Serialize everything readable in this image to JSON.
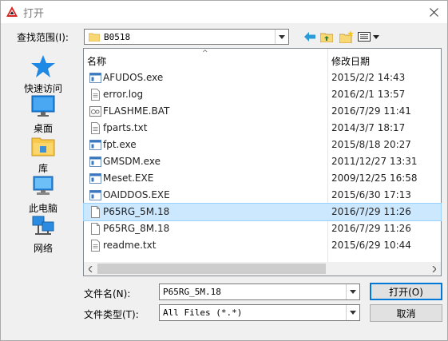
{
  "window": {
    "title": "打开"
  },
  "lookin": {
    "label": "查找范围(I):",
    "value": "B0518"
  },
  "places": [
    {
      "label": "快速访问",
      "icon": "star-icon"
    },
    {
      "label": "桌面",
      "icon": "desktop-icon"
    },
    {
      "label": "库",
      "icon": "library-icon"
    },
    {
      "label": "此电脑",
      "icon": "computer-icon"
    },
    {
      "label": "网络",
      "icon": "network-icon"
    }
  ],
  "columns": {
    "name": "名称",
    "date": "修改日期"
  },
  "files": [
    {
      "name": "AFUDOS.exe",
      "date": "2015/2/2 14:43",
      "type": "exe"
    },
    {
      "name": "error.log",
      "date": "2016/2/1 13:57",
      "type": "doc"
    },
    {
      "name": "FLASHME.BAT",
      "date": "2016/7/29 11:41",
      "type": "bat"
    },
    {
      "name": "fparts.txt",
      "date": "2014/3/7 18:17",
      "type": "doc"
    },
    {
      "name": "fpt.exe",
      "date": "2015/8/18 20:27",
      "type": "exe"
    },
    {
      "name": "GMSDM.exe",
      "date": "2011/12/27 13:31",
      "type": "exe"
    },
    {
      "name": "Meset.EXE",
      "date": "2009/12/25 16:58",
      "type": "exe"
    },
    {
      "name": "OAIDDOS.EXE",
      "date": "2015/6/30 17:13",
      "type": "exe"
    },
    {
      "name": "P65RG_5M.18",
      "date": "2016/7/29 11:26",
      "type": "blank",
      "selected": true
    },
    {
      "name": "P65RG_8M.18",
      "date": "2016/7/29 11:26",
      "type": "blank"
    },
    {
      "name": "readme.txt",
      "date": "2015/6/29 10:44",
      "type": "doc"
    }
  ],
  "filename": {
    "label": "文件名(N):",
    "value": "P65RG_5M.18"
  },
  "filetype": {
    "label": "文件类型(T):",
    "value": "All Files (*.*)"
  },
  "buttons": {
    "open": "打开(O)",
    "cancel": "取消"
  },
  "colors": {
    "accent": "#0078d7",
    "selection": "#cce8ff",
    "selection_border": "#99d1ff"
  }
}
